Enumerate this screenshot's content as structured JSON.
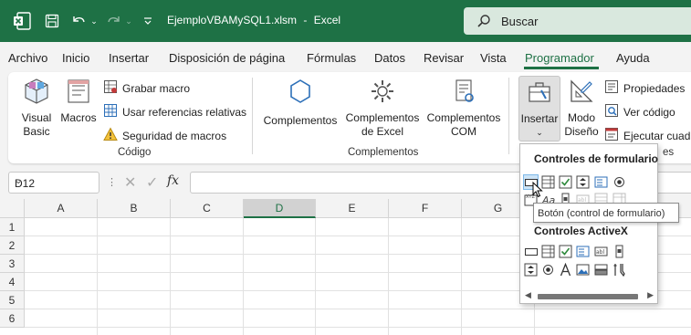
{
  "titlebar": {
    "filename": "EjemploVBAMySQL1.xlsm",
    "separator": "-",
    "app": "Excel",
    "search_placeholder": "Buscar",
    "icons": [
      "excel-logo-icon",
      "save-icon",
      "undo-icon",
      "redo-icon",
      "customize-qat-icon",
      "search-icon"
    ]
  },
  "menu": {
    "tabs": [
      "Archivo",
      "Inicio",
      "Insertar",
      "Disposición de página",
      "Fórmulas",
      "Datos",
      "Revisar",
      "Vista",
      "Programador",
      "Ayuda"
    ],
    "active": "Programador"
  },
  "ribbon": {
    "codigo": {
      "label": "Código",
      "visual_basic_line1": "Visual",
      "visual_basic_line2": "Basic",
      "macros": "Macros",
      "grabar_macro": "Grabar macro",
      "usar_referencias": "Usar referencias relativas",
      "seguridad": "Seguridad de macros"
    },
    "complementos": {
      "label": "Complementos",
      "complementos": "Complementos",
      "complementos_excel_line1": "Complementos",
      "complementos_excel_line2": "de Excel",
      "complementos_com_line1": "Complementos",
      "complementos_com_line2": "COM"
    },
    "controles": {
      "insertar": "Insertar",
      "modo_line1": "Modo",
      "modo_line2": "Diseño",
      "propiedades": "Propiedades",
      "ver_codigo": "Ver código",
      "ejecutar": "Ejecutar cuadr",
      "label_partial": "es"
    }
  },
  "formula_bar": {
    "name_box": "D12",
    "fx": "fx",
    "value": ""
  },
  "sheet": {
    "columns": [
      "A",
      "B",
      "C",
      "D",
      "E",
      "F",
      "G"
    ],
    "selected_column": "D",
    "rows": [
      "1",
      "2",
      "3",
      "4",
      "5",
      "6"
    ]
  },
  "insert_panel": {
    "form_controls_header": "Controles de formulario",
    "activex_header": "Controles ActiveX",
    "tooltip": "Botón (control de formulario)"
  },
  "colors": {
    "excel_green": "#1e7145",
    "search_bg": "#d9e8de"
  }
}
